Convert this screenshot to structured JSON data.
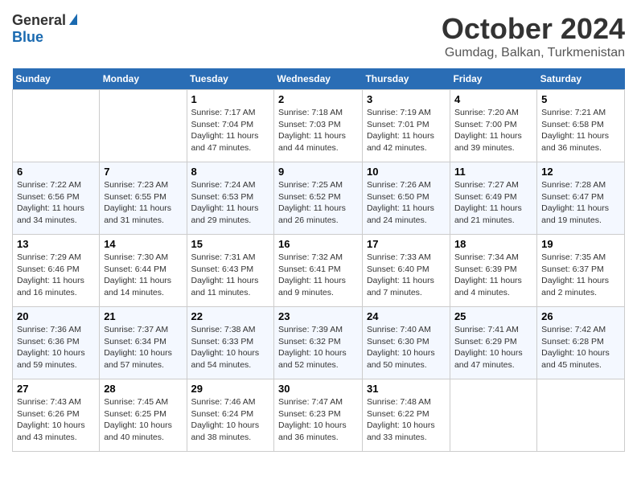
{
  "header": {
    "logo_general": "General",
    "logo_blue": "Blue",
    "month": "October 2024",
    "location": "Gumdag, Balkan, Turkmenistan"
  },
  "weekdays": [
    "Sunday",
    "Monday",
    "Tuesday",
    "Wednesday",
    "Thursday",
    "Friday",
    "Saturday"
  ],
  "weeks": [
    [
      {
        "day": "",
        "sunrise": "",
        "sunset": "",
        "daylight": ""
      },
      {
        "day": "",
        "sunrise": "",
        "sunset": "",
        "daylight": ""
      },
      {
        "day": "1",
        "sunrise": "Sunrise: 7:17 AM",
        "sunset": "Sunset: 7:04 PM",
        "daylight": "Daylight: 11 hours and 47 minutes."
      },
      {
        "day": "2",
        "sunrise": "Sunrise: 7:18 AM",
        "sunset": "Sunset: 7:03 PM",
        "daylight": "Daylight: 11 hours and 44 minutes."
      },
      {
        "day": "3",
        "sunrise": "Sunrise: 7:19 AM",
        "sunset": "Sunset: 7:01 PM",
        "daylight": "Daylight: 11 hours and 42 minutes."
      },
      {
        "day": "4",
        "sunrise": "Sunrise: 7:20 AM",
        "sunset": "Sunset: 7:00 PM",
        "daylight": "Daylight: 11 hours and 39 minutes."
      },
      {
        "day": "5",
        "sunrise": "Sunrise: 7:21 AM",
        "sunset": "Sunset: 6:58 PM",
        "daylight": "Daylight: 11 hours and 36 minutes."
      }
    ],
    [
      {
        "day": "6",
        "sunrise": "Sunrise: 7:22 AM",
        "sunset": "Sunset: 6:56 PM",
        "daylight": "Daylight: 11 hours and 34 minutes."
      },
      {
        "day": "7",
        "sunrise": "Sunrise: 7:23 AM",
        "sunset": "Sunset: 6:55 PM",
        "daylight": "Daylight: 11 hours and 31 minutes."
      },
      {
        "day": "8",
        "sunrise": "Sunrise: 7:24 AM",
        "sunset": "Sunset: 6:53 PM",
        "daylight": "Daylight: 11 hours and 29 minutes."
      },
      {
        "day": "9",
        "sunrise": "Sunrise: 7:25 AM",
        "sunset": "Sunset: 6:52 PM",
        "daylight": "Daylight: 11 hours and 26 minutes."
      },
      {
        "day": "10",
        "sunrise": "Sunrise: 7:26 AM",
        "sunset": "Sunset: 6:50 PM",
        "daylight": "Daylight: 11 hours and 24 minutes."
      },
      {
        "day": "11",
        "sunrise": "Sunrise: 7:27 AM",
        "sunset": "Sunset: 6:49 PM",
        "daylight": "Daylight: 11 hours and 21 minutes."
      },
      {
        "day": "12",
        "sunrise": "Sunrise: 7:28 AM",
        "sunset": "Sunset: 6:47 PM",
        "daylight": "Daylight: 11 hours and 19 minutes."
      }
    ],
    [
      {
        "day": "13",
        "sunrise": "Sunrise: 7:29 AM",
        "sunset": "Sunset: 6:46 PM",
        "daylight": "Daylight: 11 hours and 16 minutes."
      },
      {
        "day": "14",
        "sunrise": "Sunrise: 7:30 AM",
        "sunset": "Sunset: 6:44 PM",
        "daylight": "Daylight: 11 hours and 14 minutes."
      },
      {
        "day": "15",
        "sunrise": "Sunrise: 7:31 AM",
        "sunset": "Sunset: 6:43 PM",
        "daylight": "Daylight: 11 hours and 11 minutes."
      },
      {
        "day": "16",
        "sunrise": "Sunrise: 7:32 AM",
        "sunset": "Sunset: 6:41 PM",
        "daylight": "Daylight: 11 hours and 9 minutes."
      },
      {
        "day": "17",
        "sunrise": "Sunrise: 7:33 AM",
        "sunset": "Sunset: 6:40 PM",
        "daylight": "Daylight: 11 hours and 7 minutes."
      },
      {
        "day": "18",
        "sunrise": "Sunrise: 7:34 AM",
        "sunset": "Sunset: 6:39 PM",
        "daylight": "Daylight: 11 hours and 4 minutes."
      },
      {
        "day": "19",
        "sunrise": "Sunrise: 7:35 AM",
        "sunset": "Sunset: 6:37 PM",
        "daylight": "Daylight: 11 hours and 2 minutes."
      }
    ],
    [
      {
        "day": "20",
        "sunrise": "Sunrise: 7:36 AM",
        "sunset": "Sunset: 6:36 PM",
        "daylight": "Daylight: 10 hours and 59 minutes."
      },
      {
        "day": "21",
        "sunrise": "Sunrise: 7:37 AM",
        "sunset": "Sunset: 6:34 PM",
        "daylight": "Daylight: 10 hours and 57 minutes."
      },
      {
        "day": "22",
        "sunrise": "Sunrise: 7:38 AM",
        "sunset": "Sunset: 6:33 PM",
        "daylight": "Daylight: 10 hours and 54 minutes."
      },
      {
        "day": "23",
        "sunrise": "Sunrise: 7:39 AM",
        "sunset": "Sunset: 6:32 PM",
        "daylight": "Daylight: 10 hours and 52 minutes."
      },
      {
        "day": "24",
        "sunrise": "Sunrise: 7:40 AM",
        "sunset": "Sunset: 6:30 PM",
        "daylight": "Daylight: 10 hours and 50 minutes."
      },
      {
        "day": "25",
        "sunrise": "Sunrise: 7:41 AM",
        "sunset": "Sunset: 6:29 PM",
        "daylight": "Daylight: 10 hours and 47 minutes."
      },
      {
        "day": "26",
        "sunrise": "Sunrise: 7:42 AM",
        "sunset": "Sunset: 6:28 PM",
        "daylight": "Daylight: 10 hours and 45 minutes."
      }
    ],
    [
      {
        "day": "27",
        "sunrise": "Sunrise: 7:43 AM",
        "sunset": "Sunset: 6:26 PM",
        "daylight": "Daylight: 10 hours and 43 minutes."
      },
      {
        "day": "28",
        "sunrise": "Sunrise: 7:45 AM",
        "sunset": "Sunset: 6:25 PM",
        "daylight": "Daylight: 10 hours and 40 minutes."
      },
      {
        "day": "29",
        "sunrise": "Sunrise: 7:46 AM",
        "sunset": "Sunset: 6:24 PM",
        "daylight": "Daylight: 10 hours and 38 minutes."
      },
      {
        "day": "30",
        "sunrise": "Sunrise: 7:47 AM",
        "sunset": "Sunset: 6:23 PM",
        "daylight": "Daylight: 10 hours and 36 minutes."
      },
      {
        "day": "31",
        "sunrise": "Sunrise: 7:48 AM",
        "sunset": "Sunset: 6:22 PM",
        "daylight": "Daylight: 10 hours and 33 minutes."
      },
      {
        "day": "",
        "sunrise": "",
        "sunset": "",
        "daylight": ""
      },
      {
        "day": "",
        "sunrise": "",
        "sunset": "",
        "daylight": ""
      }
    ]
  ]
}
